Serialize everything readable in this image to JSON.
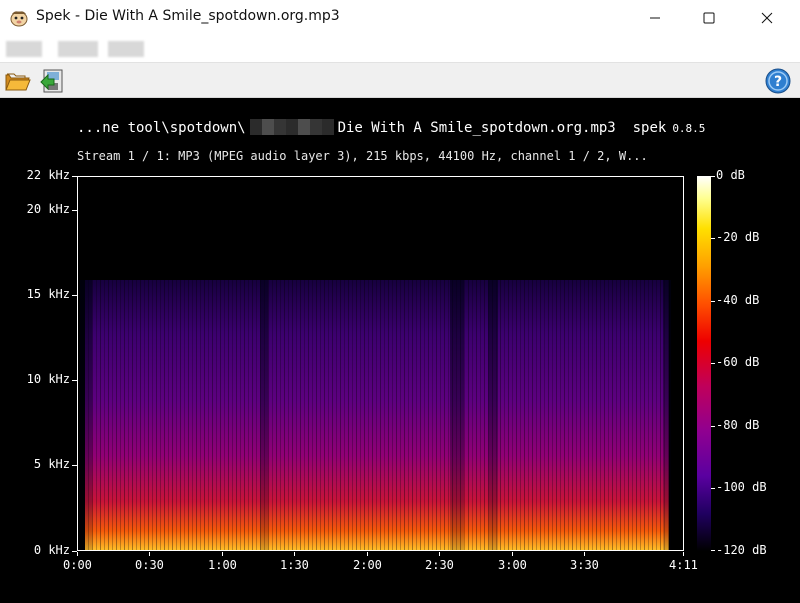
{
  "window": {
    "title": "Spek - Die With A Smile_spotdown.org.mp3"
  },
  "toolbar": {
    "open_icon": "folder-open-icon",
    "save_icon": "save-icon",
    "help_icon": "help-icon"
  },
  "header": {
    "path_prefix": "...ne tool\\spotdown\\",
    "path_suffix": "Die With A Smile_spotdown.org.mp3",
    "app_name": "spek",
    "version": "0.8.5",
    "stream_info": "Stream 1 / 1: MP3 (MPEG audio layer 3), 215 kbps, 44100 Hz, channel 1 / 2, W..."
  },
  "y_axis": {
    "labels": [
      "22 kHz",
      "20 kHz",
      "15 kHz",
      "10 kHz",
      "5 kHz",
      "0 kHz"
    ]
  },
  "x_axis": {
    "labels": [
      "0:00",
      "0:30",
      "1:00",
      "1:30",
      "2:00",
      "2:30",
      "3:00",
      "3:30",
      "4:11"
    ]
  },
  "colorbar": {
    "labels": [
      "0 dB",
      "-20 dB",
      "-40 dB",
      "-60 dB",
      "-80 dB",
      "-100 dB",
      "-120 dB"
    ],
    "top_color": "#ffffff",
    "bottom_color": "#000000"
  }
}
